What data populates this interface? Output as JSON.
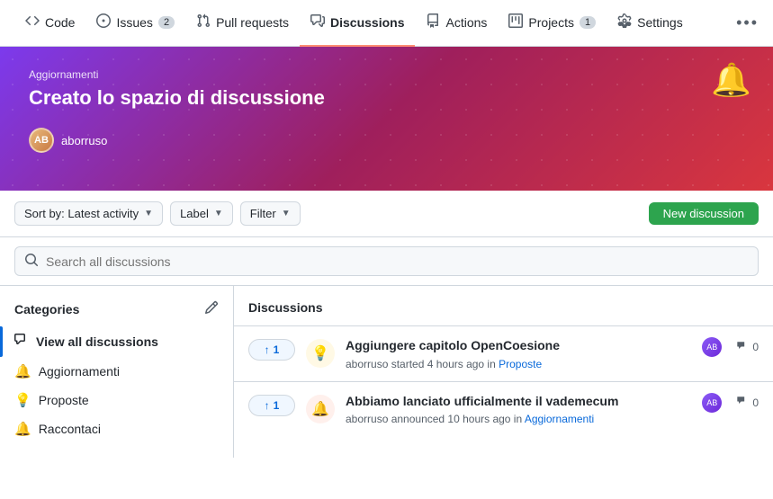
{
  "nav": {
    "items": [
      {
        "id": "code",
        "label": "Code",
        "icon": "◁▷",
        "badge": null,
        "active": false
      },
      {
        "id": "issues",
        "label": "Issues",
        "icon": "⊙",
        "badge": "2",
        "active": false
      },
      {
        "id": "pull-requests",
        "label": "Pull requests",
        "icon": "⤢",
        "badge": null,
        "active": false
      },
      {
        "id": "discussions",
        "label": "Discussions",
        "icon": "◻",
        "badge": null,
        "active": true
      },
      {
        "id": "actions",
        "label": "Actions",
        "icon": "▷",
        "badge": null,
        "active": false
      },
      {
        "id": "projects",
        "label": "Projects",
        "icon": "▦",
        "badge": "1",
        "active": false
      },
      {
        "id": "settings",
        "label": "Settings",
        "icon": "⚙",
        "badge": null,
        "active": false
      }
    ],
    "more_icon": "•••"
  },
  "hero": {
    "category": "Aggiornamenti",
    "title": "Creato lo spazio di discussione",
    "username": "aborruso",
    "bell_emoji": "🔔"
  },
  "toolbar": {
    "sort_label": "Sort by: Latest activity",
    "label_label": "Label",
    "filter_label": "Filter",
    "new_discussion_label": "New discussion"
  },
  "search": {
    "placeholder": "Search all discussions"
  },
  "sidebar": {
    "title": "Categories",
    "edit_icon": "✏",
    "items": [
      {
        "id": "view-all",
        "label": "View all discussions",
        "icon": "◻",
        "active": true,
        "color": null
      },
      {
        "id": "aggiornamenti",
        "label": "Aggiornamenti",
        "icon": "🔔",
        "active": false,
        "color": "#f97316"
      },
      {
        "id": "proposte",
        "label": "Proposte",
        "icon": "💡",
        "active": false,
        "color": "#eab308"
      },
      {
        "id": "raccontaci",
        "label": "Raccontaci",
        "icon": "🔔",
        "active": false,
        "color": "#f97316"
      }
    ]
  },
  "discussions": {
    "header": "Discussions",
    "items": [
      {
        "id": "d1",
        "vote_count": 1,
        "category_type": "proposte",
        "category_icon": "💡",
        "title": "Aggiungere capitolo OpenCoesione",
        "meta_text": "aborruso started 4 hours ago in",
        "meta_tag": "Proposte",
        "comment_count": "0"
      },
      {
        "id": "d2",
        "vote_count": 1,
        "category_type": "aggiornamenti",
        "category_icon": "🔔",
        "title": "Abbiamo lanciato ufficialmente il vademecum",
        "meta_text": "aborruso announced 10 hours ago in",
        "meta_tag": "Aggiornamenti",
        "comment_count": "0"
      }
    ]
  }
}
